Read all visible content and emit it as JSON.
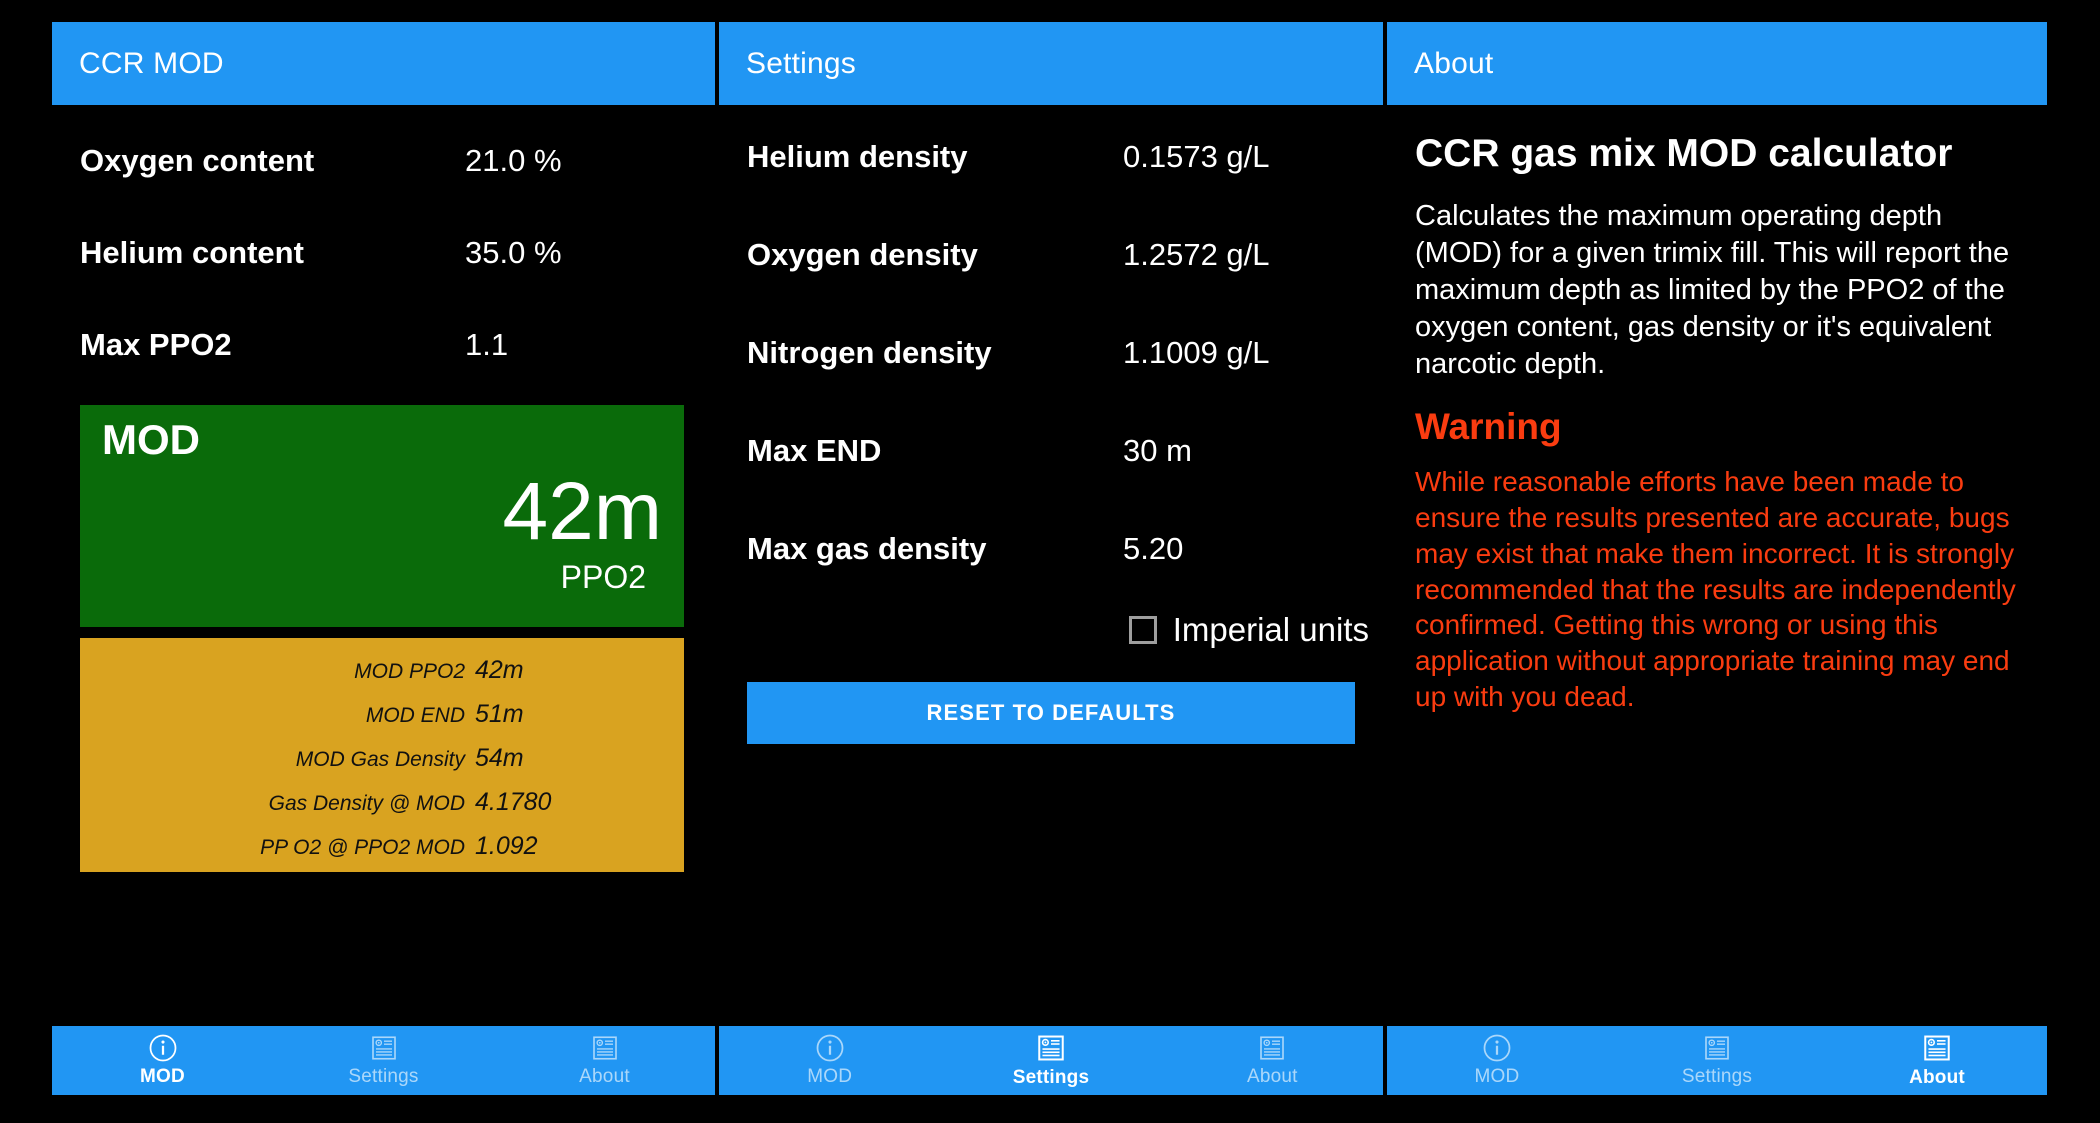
{
  "panels": {
    "mod": {
      "title": "CCR MOD",
      "fields": [
        {
          "label": "Oxygen content",
          "value": "21.0 %"
        },
        {
          "label": "Helium content",
          "value": "35.0 %"
        },
        {
          "label": "Max PPO2",
          "value": "1.1"
        }
      ],
      "result": {
        "label": "MOD",
        "value": "42m",
        "sub": "PPO2",
        "box_color": "#0A6B0A"
      },
      "details": {
        "box_color": "#D9A320",
        "rows": [
          {
            "label": "MOD PPO2",
            "value": "42m"
          },
          {
            "label": "MOD END",
            "value": "51m"
          },
          {
            "label": "MOD Gas Density",
            "value": "54m"
          },
          {
            "label": "Gas Density @ MOD",
            "value": "4.1780"
          },
          {
            "label": "PP O2 @ PPO2 MOD",
            "value": "1.092"
          }
        ]
      },
      "nav": [
        {
          "label": "MOD",
          "icon": "info-icon",
          "active": true
        },
        {
          "label": "Settings",
          "icon": "article-icon",
          "active": false
        },
        {
          "label": "About",
          "icon": "article-icon",
          "active": false
        }
      ]
    },
    "settings": {
      "title": "Settings",
      "fields": [
        {
          "label": "Helium density",
          "value": "0.1573 g/L"
        },
        {
          "label": "Oxygen density",
          "value": "1.2572 g/L"
        },
        {
          "label": "Nitrogen density",
          "value": "1.1009 g/L"
        },
        {
          "label": "Max END",
          "value": "30 m"
        },
        {
          "label": "Max gas density",
          "value": "5.20"
        }
      ],
      "imperial_units": {
        "label": "Imperial units",
        "checked": false
      },
      "reset_label": "RESET TO DEFAULTS",
      "nav": [
        {
          "label": "MOD",
          "icon": "info-icon",
          "active": false
        },
        {
          "label": "Settings",
          "icon": "article-icon",
          "active": true
        },
        {
          "label": "About",
          "icon": "article-icon",
          "active": false
        }
      ]
    },
    "about": {
      "title": "About",
      "heading": "CCR gas mix MOD calculator",
      "description": "Calculates the maximum operating depth (MOD) for a given trimix fill.  This will report the maximum depth as limited by the PPO2 of the oxygen content, gas density or it's equivalent narcotic depth.",
      "warning_title": "Warning",
      "warning_text": "While reasonable efforts have been made to ensure the results presented are accurate, bugs may exist that make them incorrect. It is strongly recommended that the results are independently confirmed. Getting this wrong or using this application without appropriate training may end up with you dead.",
      "warning_color": "#FA3C10",
      "nav": [
        {
          "label": "MOD",
          "icon": "info-icon",
          "active": false
        },
        {
          "label": "Settings",
          "icon": "article-icon",
          "active": false
        },
        {
          "label": "About",
          "icon": "article-icon",
          "active": true
        }
      ]
    }
  },
  "theme": {
    "accent": "#2196F3",
    "background": "#000000",
    "text": "#FFFFFF"
  }
}
